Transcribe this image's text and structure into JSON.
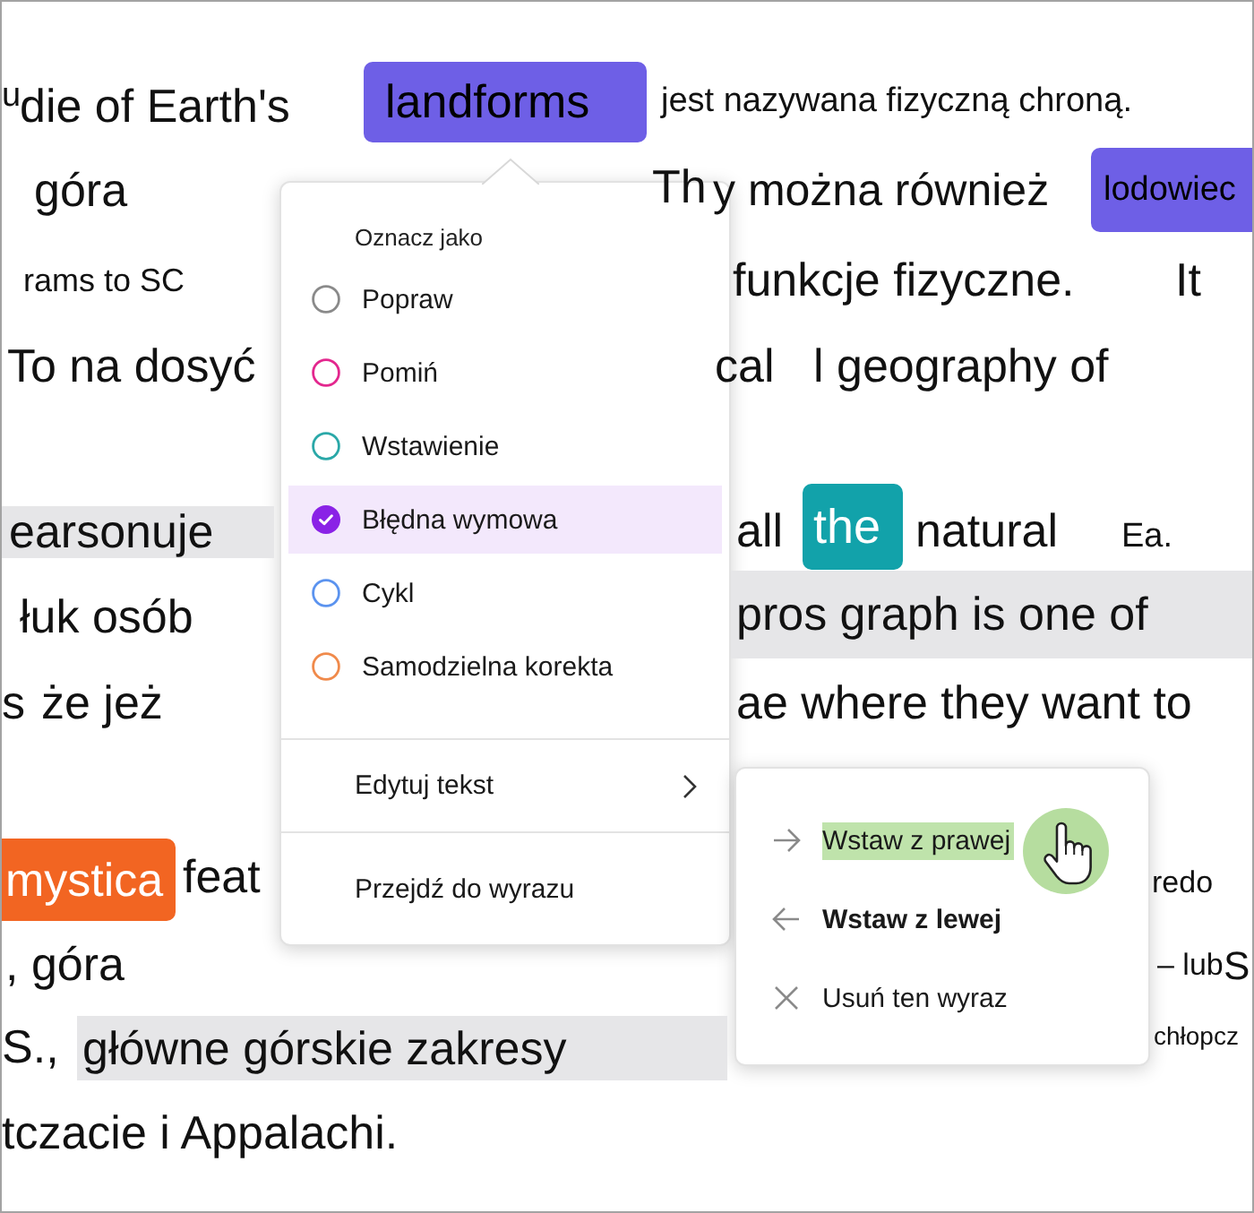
{
  "document": {
    "lines": [
      {
        "segments": [
          {
            "text": "u",
            "kind": "text"
          },
          {
            "text": "die of Earth's",
            "kind": "text"
          },
          {
            "text": "landforms",
            "kind": "chip",
            "color": "#6e5fe6"
          },
          {
            "text": "jest nazywana fizyczną chroną.",
            "kind": "text"
          }
        ]
      },
      {
        "segments": [
          {
            "text": "góra",
            "kind": "text"
          },
          {
            "text": "Th",
            "kind": "text"
          },
          {
            "text": "y można również",
            "kind": "text"
          },
          {
            "text": "lodowiec",
            "kind": "chip",
            "color": "#6e5fe6"
          }
        ]
      },
      {
        "segments": [
          {
            "text": "rams to SC",
            "kind": "text"
          },
          {
            "text": "funkcje fizyczne.",
            "kind": "text"
          },
          {
            "text": "It",
            "kind": "text"
          }
        ]
      },
      {
        "segments": [
          {
            "text": "To na dosyć",
            "kind": "text"
          },
          {
            "text": "cal",
            "kind": "text"
          },
          {
            "text": "l geography of",
            "kind": "text"
          }
        ]
      },
      {
        "segments": [
          {
            "text": "earsonuje",
            "kind": "band"
          },
          {
            "text": "all",
            "kind": "text"
          },
          {
            "text": "the",
            "kind": "chip",
            "color": "#12a2aa"
          },
          {
            "text": "natural",
            "kind": "text"
          },
          {
            "text": "Ea.",
            "kind": "text"
          }
        ]
      },
      {
        "segments": [
          {
            "text": "łuk osób",
            "kind": "text"
          },
          {
            "text": "pros graph is one of",
            "kind": "band"
          }
        ]
      },
      {
        "segments": [
          {
            "text": "s",
            "kind": "text"
          },
          {
            "text": "że jeż",
            "kind": "text"
          },
          {
            "text": "ae where they want to",
            "kind": "text"
          }
        ]
      },
      {
        "segments": [
          {
            "text": "mystica",
            "kind": "chip",
            "color": "#f26522"
          },
          {
            "text": "feat",
            "kind": "text"
          },
          {
            "text": "redo",
            "kind": "text"
          }
        ]
      },
      {
        "segments": [
          {
            "text": ", góra",
            "kind": "text"
          },
          {
            "text": "– lub",
            "kind": "text"
          },
          {
            "text": "S",
            "kind": "text"
          }
        ]
      },
      {
        "segments": [
          {
            "text": "S.,",
            "kind": "text"
          },
          {
            "text": "główne górskie zakresy",
            "kind": "band"
          },
          {
            "text": "chłopcz",
            "kind": "text"
          }
        ]
      },
      {
        "segments": [
          {
            "text": "tczacie i Appalachi.",
            "kind": "text"
          }
        ]
      }
    ]
  },
  "mark_menu": {
    "title": "Oznacz jako",
    "options": [
      {
        "label": "Popraw",
        "color": "#8a8a8a",
        "selected": false
      },
      {
        "label": "Pomiń",
        "color": "#e3278e",
        "selected": false
      },
      {
        "label": "Wstawienie",
        "color": "#2aa8a8",
        "selected": false
      },
      {
        "label": "Błędna wymowa",
        "color": "#8a22e6",
        "selected": true
      },
      {
        "label": "Cykl",
        "color": "#5b93ef",
        "selected": false
      },
      {
        "label": "Samodzielna korekta",
        "color": "#f08a4b",
        "selected": false
      }
    ],
    "actions": [
      {
        "label": "Edytuj tekst",
        "submenu": true
      },
      {
        "label": "Przejdź do wyrazu",
        "submenu": false
      }
    ]
  },
  "submenu": {
    "items": [
      {
        "label": "Wstaw z prawej",
        "kind": "right-arrow",
        "highlighted": true,
        "bold": false
      },
      {
        "label": "Wstaw z lewej",
        "kind": "left-arrow",
        "highlighted": false,
        "bold": true
      },
      {
        "label": "Usuń ten wyraz",
        "kind": "cross",
        "highlighted": false,
        "bold": false
      }
    ]
  }
}
